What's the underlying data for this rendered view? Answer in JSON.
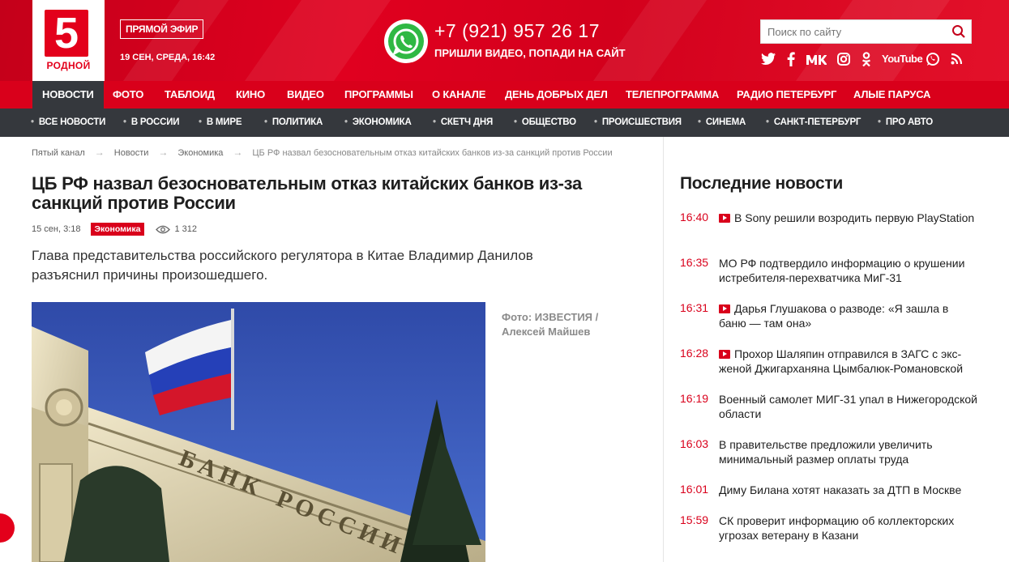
{
  "header": {
    "logo_number": "5",
    "logo_label": "РОДНОЙ",
    "live_label": "ПРЯМОЙ ЭФИР",
    "date": "19 СЕН, СРЕДА, 16:42",
    "phone": "+7 (921) 957 26 17",
    "phone_caption": "ПРИШЛИ ВИДЕО, ПОПАДИ НА САЙТ",
    "search_placeholder": "Поиск по сайту",
    "socials": [
      "twitter-icon",
      "facebook-icon",
      "vk-icon",
      "instagram-icon",
      "odnoklassniki-icon",
      "youtube-icon",
      "whatsapp-icon",
      "rss-icon"
    ],
    "youtube_label": "YouTube",
    "colors": {
      "brand_red": "#d9001b",
      "dark_nav": "#35383d"
    }
  },
  "main_nav": [
    {
      "label": "НОВОСТИ",
      "active": true
    },
    {
      "label": "ФОТО"
    },
    {
      "label": "ТАБЛОИД"
    },
    {
      "label": "КИНО"
    },
    {
      "label": "ВИДЕО"
    },
    {
      "label": "ПРОГРАММЫ"
    },
    {
      "label": "О КАНАЛЕ"
    },
    {
      "label": "ДЕНЬ ДОБРЫХ ДЕЛ"
    },
    {
      "label": "ТЕЛЕПРОГРАММА"
    },
    {
      "label": "РАДИО ПЕТЕРБУРГ"
    },
    {
      "label": "АЛЫЕ ПАРУСА"
    }
  ],
  "sub_nav": [
    {
      "label": "ВСЕ НОВОСТИ"
    },
    {
      "label": "В РОССИИ"
    },
    {
      "label": "В МИРЕ"
    },
    {
      "label": "ПОЛИТИКА"
    },
    {
      "label": "ЭКОНОМИКА",
      "active": true
    },
    {
      "label": "СКЕТЧ ДНЯ"
    },
    {
      "label": "ОБЩЕСТВО"
    },
    {
      "label": "ПРОИСШЕСТВИЯ"
    },
    {
      "label": "СИНЕМА"
    },
    {
      "label": "САНКТ-ПЕТЕРБУРГ"
    },
    {
      "label": "ПРО АВТО"
    }
  ],
  "breadcrumb": [
    "Пятый канал",
    "Новости",
    "Экономика",
    "ЦБ РФ назвал безосновательным отказ китайских банков из-за санкций против России"
  ],
  "article": {
    "title": "ЦБ РФ назвал безосновательным отказ китайских банков из-за санкций против России",
    "date": "15 сен, 3:18",
    "category": "Экономика",
    "views": "1 312",
    "lead": "Глава представительства российского регулятора в Китае Владимир Данилов разъяснил причины произошедшего.",
    "photo_credit": "Фото: ИЗВЕСТИЯ / Алексей Майшев",
    "photo_sign": "БАНК РОССИИ"
  },
  "sidebar": {
    "title": "Последние новости",
    "items": [
      {
        "time": "16:40",
        "text": "В Sony решили возродить первую PlayStation",
        "video": true
      },
      {
        "time": "16:35",
        "text": "МО РФ подтвердило информацию о крушении истребителя-перехватчика МиГ-31",
        "video": false
      },
      {
        "time": "16:31",
        "text": "Дарья Глушакова о разводе: «Я зашла в баню — там она»",
        "video": true
      },
      {
        "time": "16:28",
        "text": "Прохор Шаляпин отправился в ЗАГС с экс-женой Джигарханяна Цымбалюк-Романовской",
        "video": true
      },
      {
        "time": "16:19",
        "text": "Военный самолет МИГ-31 упал в Нижегородской области",
        "video": false
      },
      {
        "time": "16:03",
        "text": "В правительстве предложили увеличить минимальный размер оплаты труда",
        "video": false
      },
      {
        "time": "16:01",
        "text": "Диму Билана хотят наказать за ДТП в Москве",
        "video": false
      },
      {
        "time": "15:59",
        "text": "СК проверит информацию об коллекторских угрозах ветерану в Казани",
        "video": false
      }
    ]
  }
}
